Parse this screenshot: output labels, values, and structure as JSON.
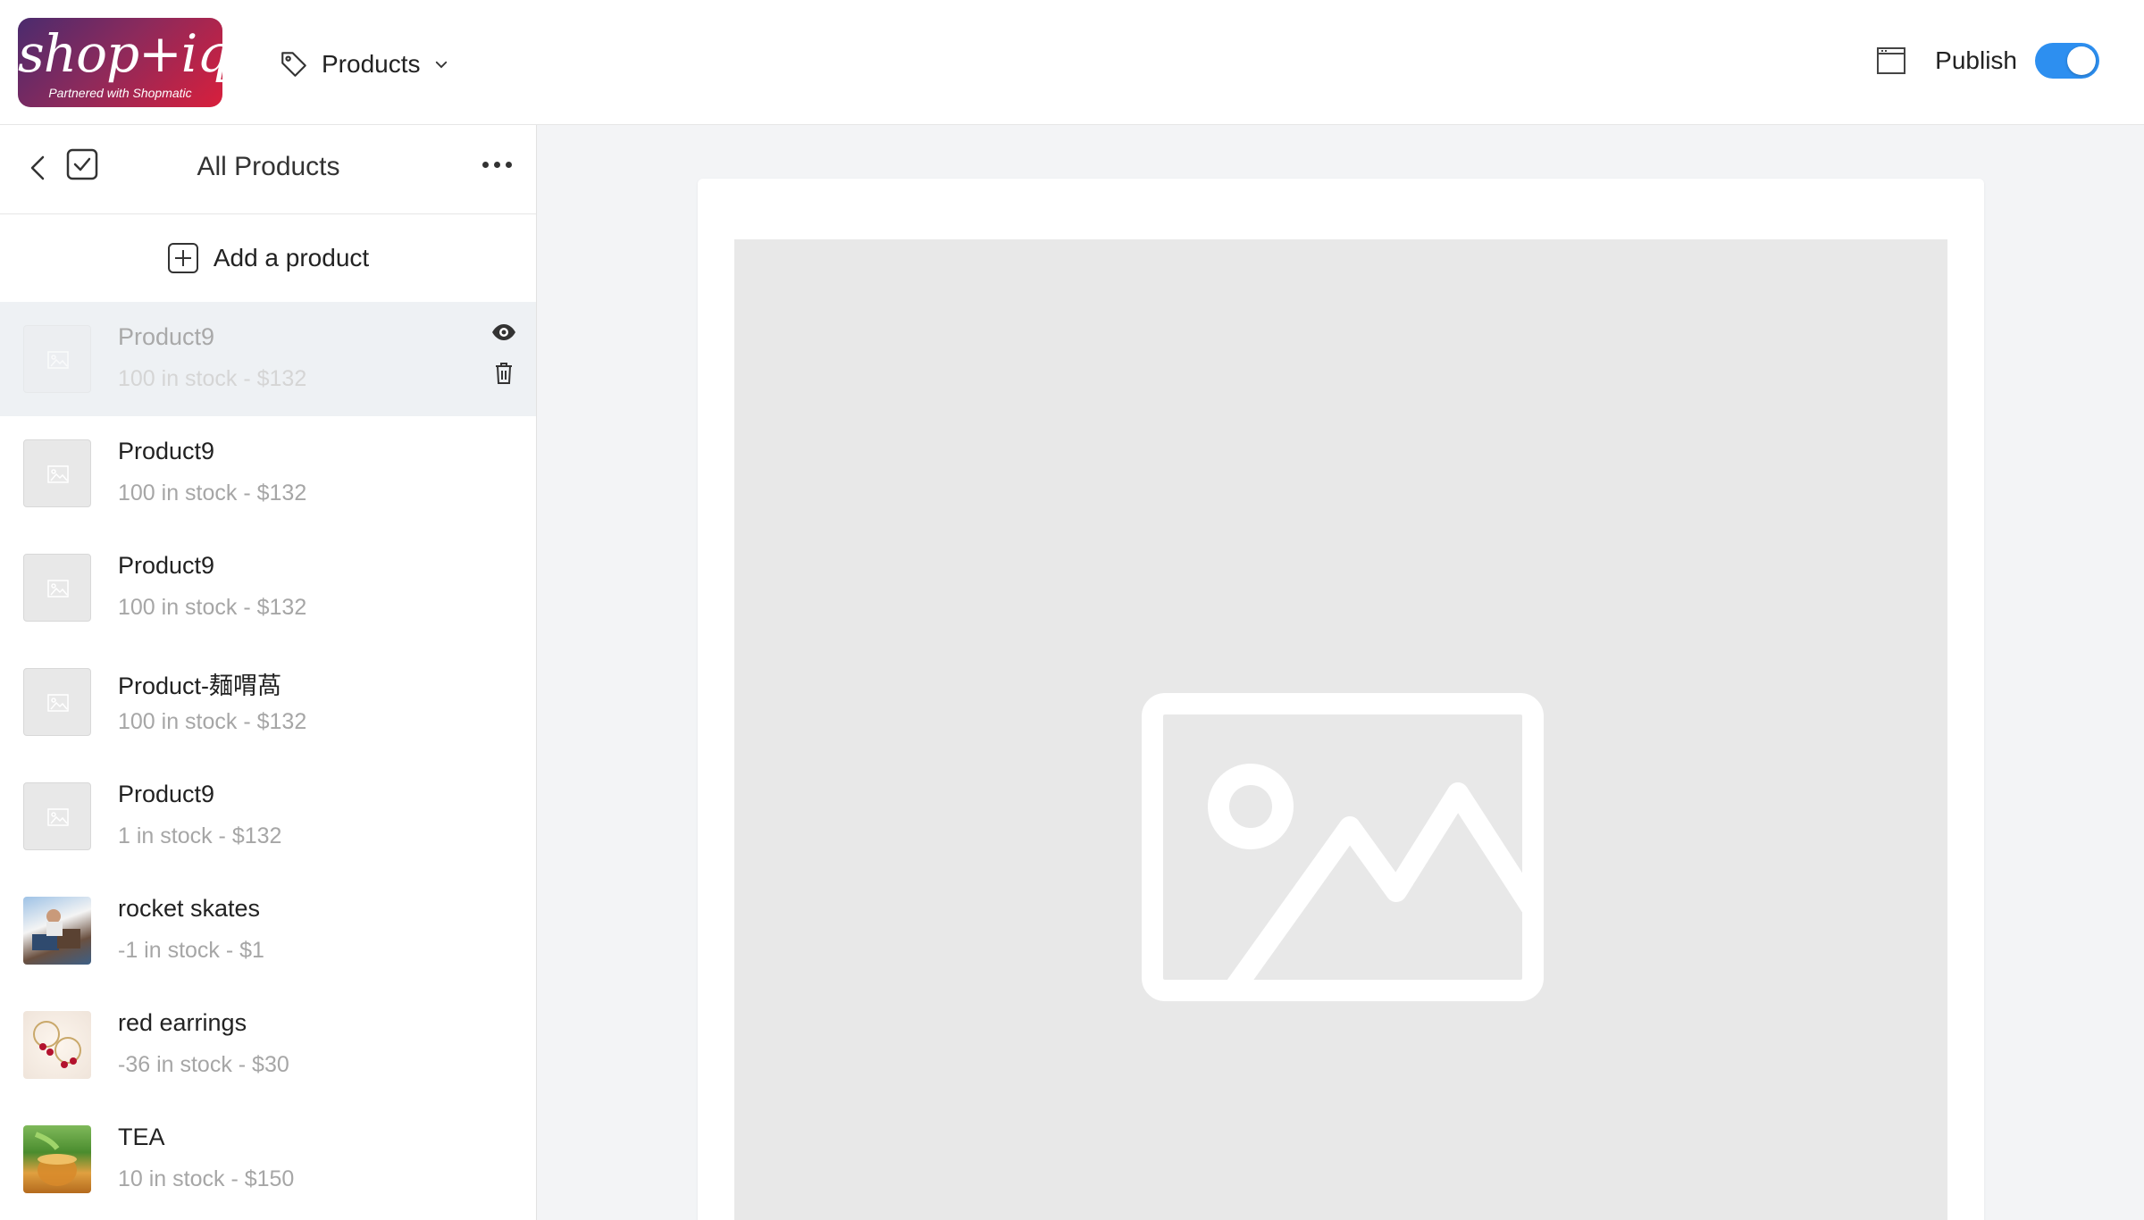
{
  "brand": {
    "logo_text": "shop+iq",
    "logo_subtext": "Partnered with Shopmatic",
    "logo_colors": [
      "#4a2b6e",
      "#d81f3c"
    ]
  },
  "header": {
    "nav_label": "Products",
    "nav_icon": "tag-icon",
    "publish_label": "Publish",
    "publish_enabled": true,
    "toggle_color": "#2d8ff0"
  },
  "sidebar": {
    "title": "All Products",
    "add_label": "Add a product",
    "products": [
      {
        "name": "Product9",
        "meta": "100 in stock - $132",
        "image": "placeholder",
        "selected": true
      },
      {
        "name": "Product9",
        "meta": "100 in stock - $132",
        "image": "placeholder"
      },
      {
        "name": "Product9",
        "meta": "100 in stock - $132",
        "image": "placeholder"
      },
      {
        "name": "Product-麺喟萵",
        "meta": "100 in stock - $132",
        "image": "placeholder"
      },
      {
        "name": "Product9",
        "meta": "1 in stock - $132",
        "image": "placeholder"
      },
      {
        "name": "rocket skates",
        "meta": "-1 in stock - $1",
        "image": "photo-skates"
      },
      {
        "name": "red earrings",
        "meta": "-36 in stock - $30",
        "image": "photo-earrings"
      },
      {
        "name": "TEA",
        "meta": "10 in stock - $150",
        "image": "photo-tea"
      }
    ]
  }
}
